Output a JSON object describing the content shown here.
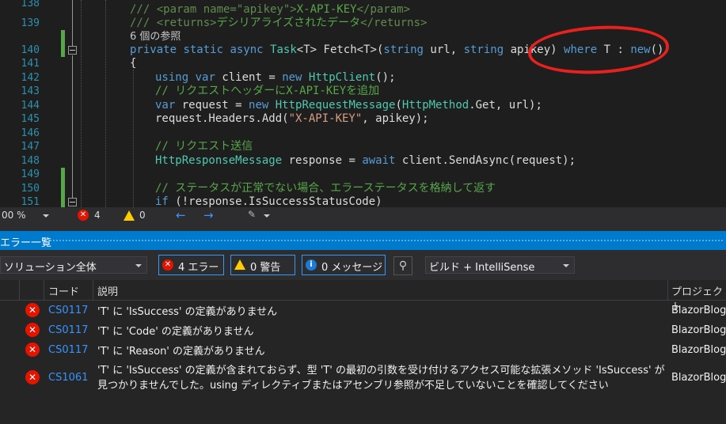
{
  "editor": {
    "line_numbers": [
      "138",
      "139",
      "",
      "140",
      "141",
      "142",
      "143",
      "144",
      "145",
      "146",
      "147",
      "148",
      "149",
      "150",
      "151"
    ],
    "comment_param_open": "/// ",
    "comment_param_tag": "<param name=\"apikey\">",
    "comment_param_text": "X-API-KEY",
    "comment_param_close": "</param>",
    "comment_returns_prefix": "/// ",
    "comment_returns_tag": "<returns>",
    "comment_returns_text": "デシリアライズされたデータ",
    "comment_returns_close": "</returns>",
    "codelens": "6 個の参照",
    "sig_private": "private",
    "sig_static": "static",
    "sig_async": "async",
    "sig_task": "Task",
    "sig_t1": "<T>",
    "sig_fetch": "Fetch",
    "sig_t2": "<T>",
    "sig_paren": "(",
    "sig_string1": "string",
    "sig_url": " url, ",
    "sig_string2": "string",
    "sig_apikey": " apikey",
    "sig_close": ") ",
    "sig_where": "where",
    "sig_tconstraint": " T : ",
    "sig_new": "new",
    "sig_newparen": "()",
    "brace": "{",
    "l142_using": "using",
    "l142_var": "var",
    "l142_mid": " client = ",
    "l142_new": "new",
    "l142_type": "HttpClient",
    "l142_end": "();",
    "l143_comment": "// リクエストヘッダーにX-API-KEYを追加",
    "l144_var": "var",
    "l144_mid": " request = ",
    "l144_new": "new",
    "l144_type": "HttpRequestMessage",
    "l144_p": "(",
    "l144_type2": "HttpMethod",
    "l144_end": ".Get, url);",
    "l145_a": "request.Headers.Add(",
    "l145_str": "\"X-API-KEY\"",
    "l145_end": ", apikey);",
    "l147_comment": "// リクエスト送信",
    "l148_type": "HttpResponseMessage",
    "l148_mid": " response = ",
    "l148_await": "await",
    "l148_end": " client.SendAsync(request);",
    "l150_comment": "// ステータスが正常でない場合、エラーステータスを格納して返す",
    "l151_if": "if",
    "l151_end": " (!response.IsSuccessStatusCode)"
  },
  "editor_status": {
    "zoom": "00 %",
    "errors": "4",
    "warnings": "0"
  },
  "panel": {
    "title": "エラー一覧"
  },
  "toolbar": {
    "scope": "ソリューション全体",
    "errors_btn": "4 エラー",
    "warnings_btn": "0 警告",
    "messages_btn": "0 メッセージ",
    "build_filter": "ビルド + IntelliSense"
  },
  "grid": {
    "col_code": "コード",
    "col_desc": "説明",
    "col_project": "プロジェクト",
    "rows": [
      {
        "code": "CS0117",
        "desc": "'T' に 'IsSuccess' の定義がありません",
        "project": "BlazorBlog"
      },
      {
        "code": "CS0117",
        "desc": "'T' に 'Code' の定義がありません",
        "project": "BlazorBlog"
      },
      {
        "code": "CS0117",
        "desc": "'T' に 'Reason' の定義がありません",
        "project": "BlazorBlog"
      },
      {
        "code": "CS1061",
        "desc": "'T' に 'IsSuccess' の定義が含まれておらず、型 'T' の最初の引数を受け付けるアクセス可能な拡張メソッド 'IsSuccess' が見つかりませんでした。using ディレクティブまたはアセンブリ参照が不足していないことを確認してください",
        "project": "BlazorBlog"
      }
    ]
  },
  "colors": {
    "accent": "#007acc",
    "error": "#e51400",
    "annotation": "#e8211f"
  }
}
